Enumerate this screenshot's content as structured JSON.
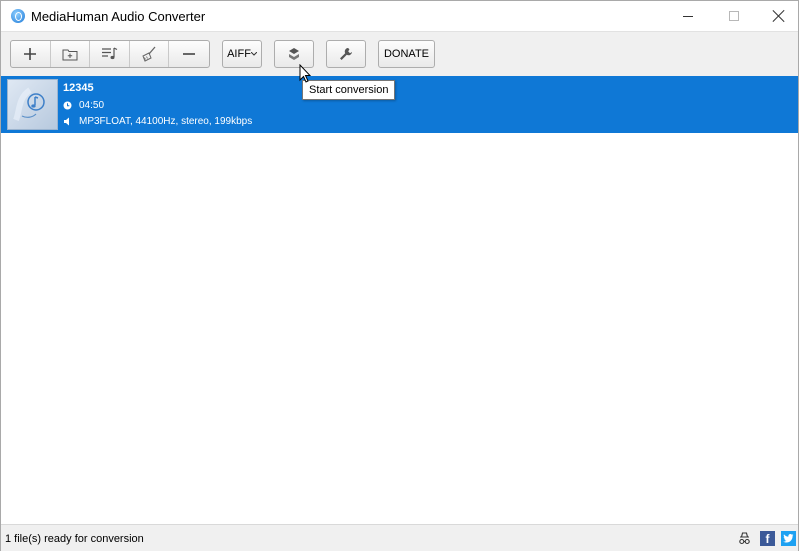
{
  "window": {
    "title": "MediaHuman Audio Converter"
  },
  "toolbar": {
    "buttons": [
      {
        "name": "add-file",
        "icon": "plus-icon"
      },
      {
        "name": "add-folder",
        "icon": "folder-plus-icon"
      },
      {
        "name": "add-itunes",
        "icon": "music-list-icon"
      },
      {
        "name": "clear-list",
        "icon": "broom-icon"
      },
      {
        "name": "remove",
        "icon": "minus-icon"
      }
    ],
    "format_label": "AIFF",
    "start_icon": "start-conversion-icon",
    "settings_icon": "wrench-icon",
    "donate_label": "DONATE"
  },
  "tooltip": {
    "text": "Start conversion"
  },
  "file_list": {
    "items": [
      {
        "name": "12345",
        "duration": "04:50",
        "format": "MP3FLOAT, 44100Hz, stereo, 199kbps",
        "selected": true
      }
    ]
  },
  "status": {
    "text": "1 file(s) ready for conversion",
    "facebook_glyph": "f"
  },
  "colors": {
    "selection": "#0f78d6",
    "toolbar_bg": "#f0f0f0",
    "facebook": "#3b5998",
    "twitter": "#1da1f2"
  }
}
